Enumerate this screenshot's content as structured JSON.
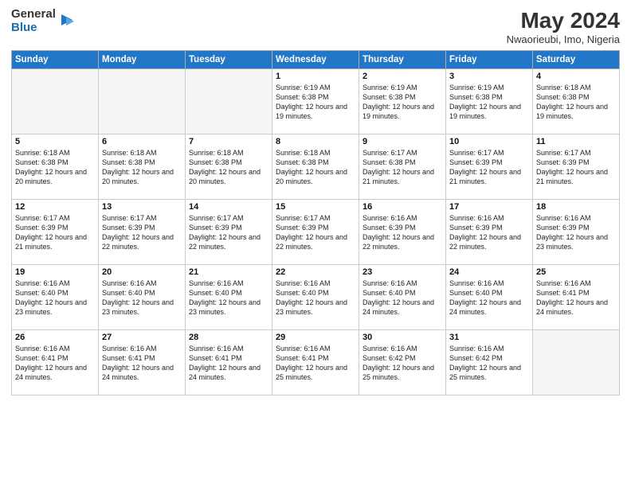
{
  "header": {
    "logo": {
      "general": "General",
      "blue": "Blue"
    },
    "title": "May 2024",
    "location": "Nwaorieubi, Imo, Nigeria"
  },
  "weekdays": [
    "Sunday",
    "Monday",
    "Tuesday",
    "Wednesday",
    "Thursday",
    "Friday",
    "Saturday"
  ],
  "weeks": [
    [
      {
        "day": "",
        "info": ""
      },
      {
        "day": "",
        "info": ""
      },
      {
        "day": "",
        "info": ""
      },
      {
        "day": "1",
        "info": "Sunrise: 6:19 AM\nSunset: 6:38 PM\nDaylight: 12 hours and 19 minutes."
      },
      {
        "day": "2",
        "info": "Sunrise: 6:19 AM\nSunset: 6:38 PM\nDaylight: 12 hours and 19 minutes."
      },
      {
        "day": "3",
        "info": "Sunrise: 6:19 AM\nSunset: 6:38 PM\nDaylight: 12 hours and 19 minutes."
      },
      {
        "day": "4",
        "info": "Sunrise: 6:18 AM\nSunset: 6:38 PM\nDaylight: 12 hours and 19 minutes."
      }
    ],
    [
      {
        "day": "5",
        "info": "Sunrise: 6:18 AM\nSunset: 6:38 PM\nDaylight: 12 hours and 20 minutes."
      },
      {
        "day": "6",
        "info": "Sunrise: 6:18 AM\nSunset: 6:38 PM\nDaylight: 12 hours and 20 minutes."
      },
      {
        "day": "7",
        "info": "Sunrise: 6:18 AM\nSunset: 6:38 PM\nDaylight: 12 hours and 20 minutes."
      },
      {
        "day": "8",
        "info": "Sunrise: 6:18 AM\nSunset: 6:38 PM\nDaylight: 12 hours and 20 minutes."
      },
      {
        "day": "9",
        "info": "Sunrise: 6:17 AM\nSunset: 6:38 PM\nDaylight: 12 hours and 21 minutes."
      },
      {
        "day": "10",
        "info": "Sunrise: 6:17 AM\nSunset: 6:39 PM\nDaylight: 12 hours and 21 minutes."
      },
      {
        "day": "11",
        "info": "Sunrise: 6:17 AM\nSunset: 6:39 PM\nDaylight: 12 hours and 21 minutes."
      }
    ],
    [
      {
        "day": "12",
        "info": "Sunrise: 6:17 AM\nSunset: 6:39 PM\nDaylight: 12 hours and 21 minutes."
      },
      {
        "day": "13",
        "info": "Sunrise: 6:17 AM\nSunset: 6:39 PM\nDaylight: 12 hours and 22 minutes."
      },
      {
        "day": "14",
        "info": "Sunrise: 6:17 AM\nSunset: 6:39 PM\nDaylight: 12 hours and 22 minutes."
      },
      {
        "day": "15",
        "info": "Sunrise: 6:17 AM\nSunset: 6:39 PM\nDaylight: 12 hours and 22 minutes."
      },
      {
        "day": "16",
        "info": "Sunrise: 6:16 AM\nSunset: 6:39 PM\nDaylight: 12 hours and 22 minutes."
      },
      {
        "day": "17",
        "info": "Sunrise: 6:16 AM\nSunset: 6:39 PM\nDaylight: 12 hours and 22 minutes."
      },
      {
        "day": "18",
        "info": "Sunrise: 6:16 AM\nSunset: 6:39 PM\nDaylight: 12 hours and 23 minutes."
      }
    ],
    [
      {
        "day": "19",
        "info": "Sunrise: 6:16 AM\nSunset: 6:40 PM\nDaylight: 12 hours and 23 minutes."
      },
      {
        "day": "20",
        "info": "Sunrise: 6:16 AM\nSunset: 6:40 PM\nDaylight: 12 hours and 23 minutes."
      },
      {
        "day": "21",
        "info": "Sunrise: 6:16 AM\nSunset: 6:40 PM\nDaylight: 12 hours and 23 minutes."
      },
      {
        "day": "22",
        "info": "Sunrise: 6:16 AM\nSunset: 6:40 PM\nDaylight: 12 hours and 23 minutes."
      },
      {
        "day": "23",
        "info": "Sunrise: 6:16 AM\nSunset: 6:40 PM\nDaylight: 12 hours and 24 minutes."
      },
      {
        "day": "24",
        "info": "Sunrise: 6:16 AM\nSunset: 6:40 PM\nDaylight: 12 hours and 24 minutes."
      },
      {
        "day": "25",
        "info": "Sunrise: 6:16 AM\nSunset: 6:41 PM\nDaylight: 12 hours and 24 minutes."
      }
    ],
    [
      {
        "day": "26",
        "info": "Sunrise: 6:16 AM\nSunset: 6:41 PM\nDaylight: 12 hours and 24 minutes."
      },
      {
        "day": "27",
        "info": "Sunrise: 6:16 AM\nSunset: 6:41 PM\nDaylight: 12 hours and 24 minutes."
      },
      {
        "day": "28",
        "info": "Sunrise: 6:16 AM\nSunset: 6:41 PM\nDaylight: 12 hours and 24 minutes."
      },
      {
        "day": "29",
        "info": "Sunrise: 6:16 AM\nSunset: 6:41 PM\nDaylight: 12 hours and 25 minutes."
      },
      {
        "day": "30",
        "info": "Sunrise: 6:16 AM\nSunset: 6:42 PM\nDaylight: 12 hours and 25 minutes."
      },
      {
        "day": "31",
        "info": "Sunrise: 6:16 AM\nSunset: 6:42 PM\nDaylight: 12 hours and 25 minutes."
      },
      {
        "day": "",
        "info": ""
      }
    ]
  ]
}
